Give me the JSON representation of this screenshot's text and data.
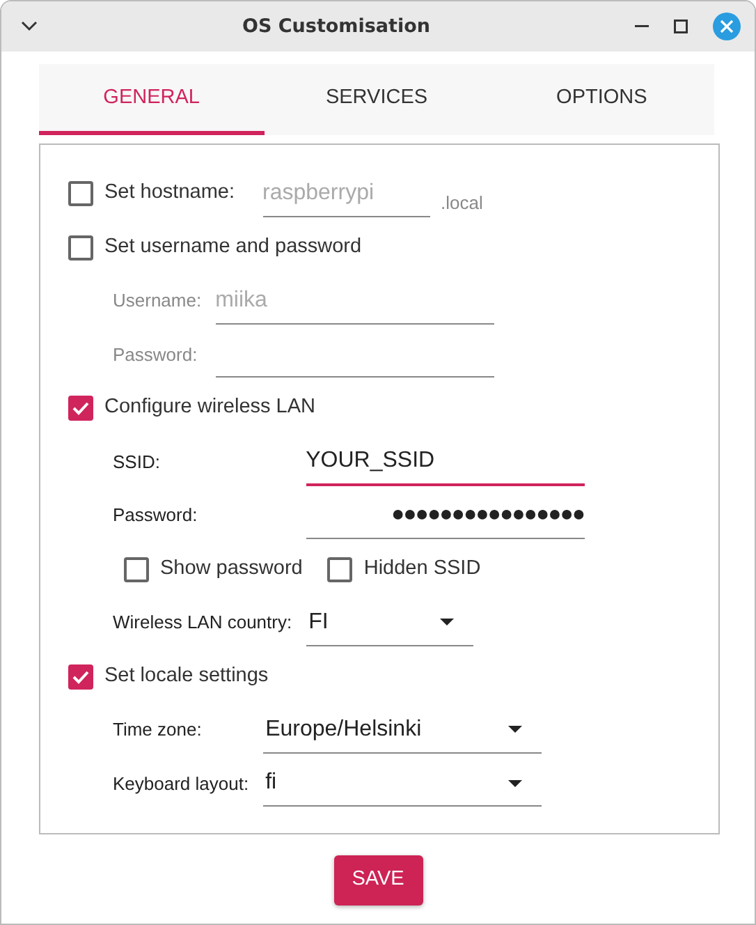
{
  "window": {
    "title": "OS Customisation"
  },
  "tabs": [
    {
      "label": "GENERAL",
      "selected": true
    },
    {
      "label": "SERVICES",
      "selected": false
    },
    {
      "label": "OPTIONS",
      "selected": false
    }
  ],
  "sections": [
    {
      "checkbox": {
        "label": "Set hostname:",
        "checked": false
      },
      "inline_field": {
        "placeholder": "raspberrypi",
        "suffix": ".local"
      }
    },
    {
      "checkbox": {
        "label": "Set username and password",
        "checked": false
      },
      "fields": [
        {
          "kind": "text",
          "label": "Username:",
          "placeholder": "miika"
        },
        {
          "kind": "text",
          "label": "Password:"
        }
      ]
    },
    {
      "checkbox": {
        "label": "Configure wireless LAN",
        "checked": true
      },
      "fields": [
        {
          "kind": "text",
          "label": "SSID:",
          "value": "YOUR_SSID",
          "focused": true
        },
        {
          "kind": "text",
          "label": "Password:",
          "value": "●●●●●●●●●●●●●●●●"
        },
        {
          "kind": "options",
          "options": [
            {
              "label": "Show password",
              "checked": false
            },
            {
              "label": "Hidden SSID",
              "checked": false
            }
          ]
        },
        {
          "kind": "select",
          "label": "Wireless LAN country:",
          "value": "FI"
        }
      ]
    },
    {
      "checkbox": {
        "label": "Set locale settings",
        "checked": true
      },
      "fields": [
        {
          "kind": "select",
          "label": "Time zone:",
          "value": "Europe/Helsinki"
        },
        {
          "kind": "select",
          "label": "Keyboard layout:",
          "value": "fi"
        }
      ]
    }
  ],
  "save_button": "SAVE"
}
